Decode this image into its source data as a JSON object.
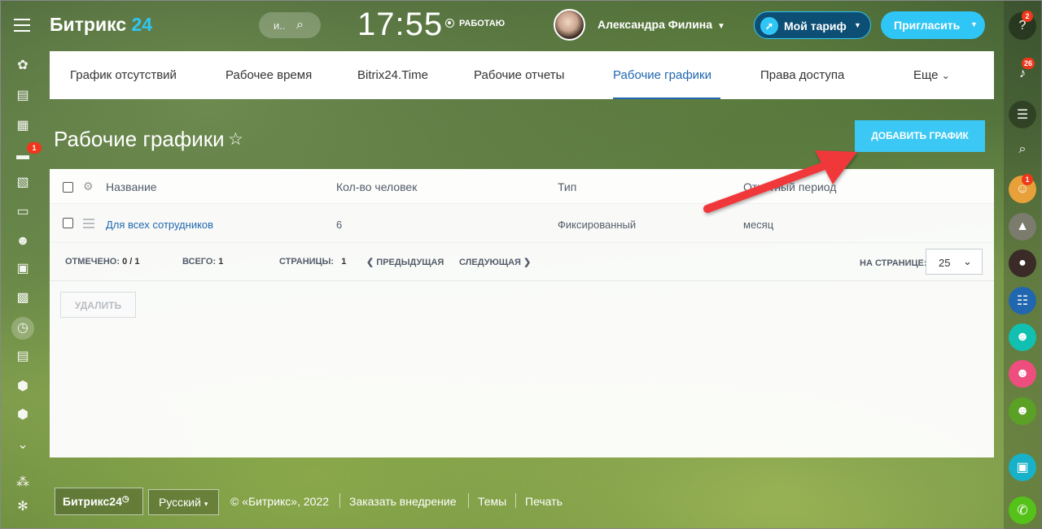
{
  "header": {
    "logo_text": "Битрикс",
    "logo_num": "24",
    "search_placeholder": "и..",
    "clock": "17:55",
    "work_status": "РАБОТАЮ",
    "user_name": "Александра Филина",
    "tariff_label": "Мой тариф",
    "invite_label": "Пригласить"
  },
  "left_bar": {
    "badge": "1"
  },
  "right_bar": {
    "help_badge": "2",
    "notify_badge": "26",
    "avatar_badge": "1"
  },
  "tabs": [
    {
      "label": "График отсутствий"
    },
    {
      "label": "Рабочее время"
    },
    {
      "label": "Bitrix24.Time"
    },
    {
      "label": "Рабочие отчеты"
    },
    {
      "label": "Рабочие графики",
      "active": true
    },
    {
      "label": "Права доступа"
    },
    {
      "label": "Еще"
    }
  ],
  "page": {
    "title": "Рабочие графики",
    "add_button": "ДОБАВИТЬ ГРАФИК"
  },
  "grid": {
    "columns": [
      "Название",
      "Кол-во человек",
      "Тип",
      "Отчетный период"
    ],
    "rows": [
      {
        "name": "Для всех сотрудников",
        "count": "6",
        "type": "Фиксированный",
        "period": "месяц"
      }
    ],
    "footer": {
      "checked_label": "ОТМЕЧЕНО:",
      "checked_value": "0 / 1",
      "total_label": "ВСЕГО:",
      "total_value": "1",
      "pages_label": "СТРАНИЦЫ:",
      "pages_value": "1",
      "prev": "ПРЕДЫДУЩАЯ",
      "next": "СЛЕДУЮЩАЯ",
      "per_page_label": "НА СТРАНИЦЕ:",
      "per_page_value": "25"
    },
    "delete_button": "УДАЛИТЬ"
  },
  "bottom": {
    "logo": "Битрикс24",
    "language": "Русский",
    "copyright": "© «Битрикс», 2022",
    "order": "Заказать внедрение",
    "themes": "Темы",
    "print": "Печать"
  },
  "colors": {
    "accent": "#2fc6f6",
    "link": "#2067b0",
    "badge": "#f0371b",
    "arrow": "#f0373b"
  }
}
